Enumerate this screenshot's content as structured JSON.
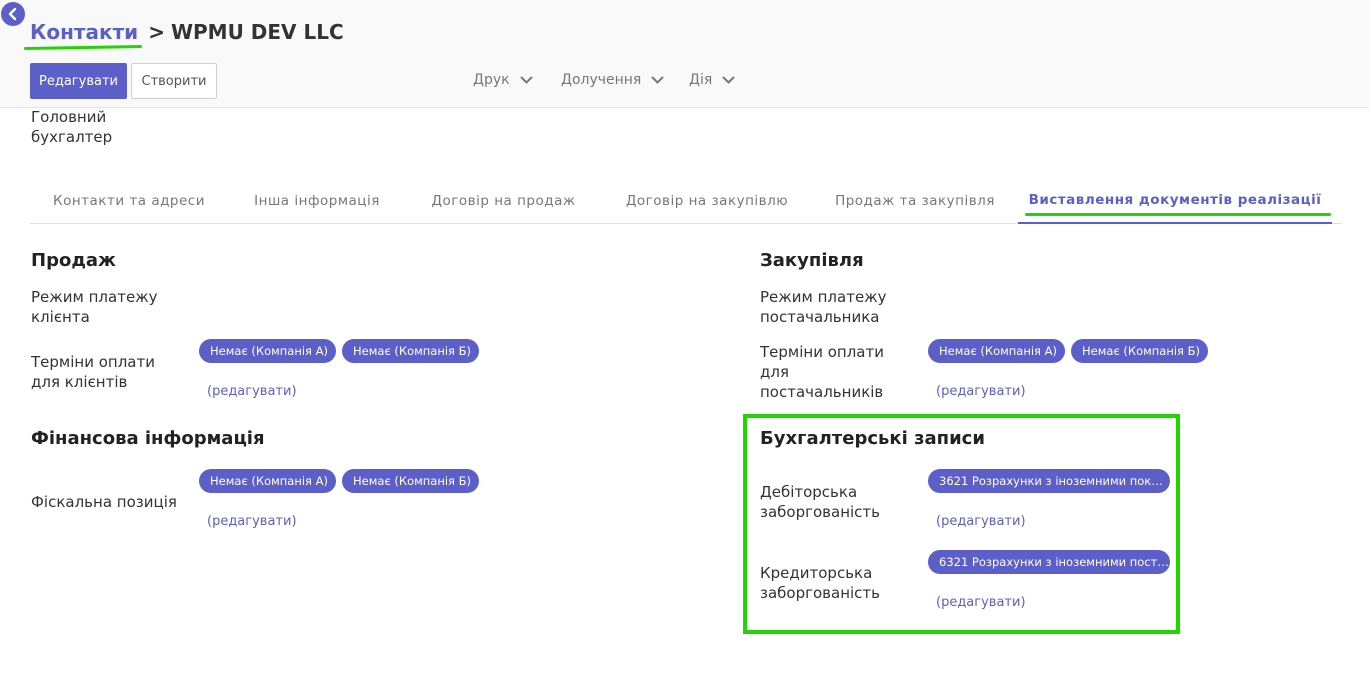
{
  "breadcrumb": {
    "parent": "Контакти",
    "separator": ">",
    "current": "WPMU DEV LLC"
  },
  "toolbar": {
    "edit_label": "Редагувати",
    "create_label": "Створити",
    "print_label": "Друк",
    "attach_label": "Долучення",
    "action_label": "Дія"
  },
  "header_field": {
    "line1": "Головний",
    "line2": "бухгалтер"
  },
  "tabs": [
    {
      "label": "Контакти та адреси"
    },
    {
      "label": "Інша інформація"
    },
    {
      "label": "Договір на продаж"
    },
    {
      "label": "Договір на закупівлю"
    },
    {
      "label": "Продаж та закупівля"
    },
    {
      "label": "Виставлення документів реалізації"
    }
  ],
  "sales": {
    "title": "Продаж",
    "payment_mode_line1": "Режим платежу",
    "payment_mode_line2": "клієнта",
    "terms_line1": "Терміни оплати",
    "terms_line2": "для клієнтів",
    "tag_a": "Немає (Компанія А)",
    "tag_b": "Немає (Компанія Б)",
    "edit_link": "(редагувати)"
  },
  "fiscal": {
    "title": "Фінансова інформація",
    "position_label": "Фіскальна позиція",
    "tag_a": "Немає (Компанія А)",
    "tag_b": "Немає (Компанія Б)",
    "edit_link": "(редагувати)"
  },
  "purchase": {
    "title": "Закупівля",
    "payment_mode_line1": "Режим платежу",
    "payment_mode_line2": "постачальника",
    "terms_line1": "Терміни оплати",
    "terms_line2": "для",
    "terms_line3": "постачальників",
    "tag_a": "Немає (Компанія А)",
    "tag_b": "Немає (Компанія Б)",
    "edit_link": "(редагувати)"
  },
  "accounting": {
    "title": "Бухгалтерські записи",
    "receivable_line1": "Дебіторська",
    "receivable_line2": "заборгованість",
    "receivable_tag": "3621 Розрахунки з іноземними пок…",
    "receivable_edit": "(редагувати)",
    "payable_line1": "Кредиторська",
    "payable_line2": "заборгованість",
    "payable_tag": "6321 Розрахунки з іноземними пост…",
    "payable_edit": "(редагувати)"
  },
  "colors": {
    "accent": "#5b5fc7",
    "highlight": "#1fd600"
  }
}
